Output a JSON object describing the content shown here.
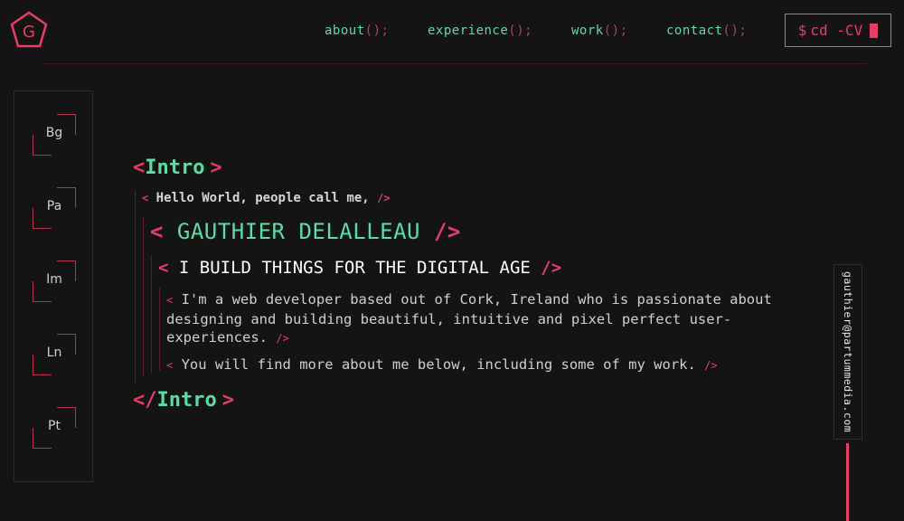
{
  "logo": {
    "letter": "G",
    "color": "#e63e66"
  },
  "nav": {
    "items": [
      {
        "label": "about",
        "suffix": "();"
      },
      {
        "label": "experience",
        "suffix": "();"
      },
      {
        "label": "work",
        "suffix": "();"
      },
      {
        "label": "contact",
        "suffix": "();"
      }
    ],
    "cv_prompt": "$",
    "cv_label": "cd -CV"
  },
  "sidebar": {
    "items": [
      {
        "symbol": "Bg",
        "icon": "github-icon"
      },
      {
        "symbol": "Pa",
        "icon": "codepen-icon"
      },
      {
        "symbol": "Im",
        "icon": "instagram-icon"
      },
      {
        "symbol": "Ln",
        "icon": "linkedin-icon"
      },
      {
        "symbol": "Pt",
        "icon": "twitter-icon"
      }
    ]
  },
  "intro": {
    "open_tag": "<",
    "close_open": "</",
    "end_tag": ">",
    "self_close": "/>",
    "section_name": "Intro",
    "hello": "Hello World, people call me,",
    "name": "GAUTHIER DELALLEAU",
    "tagline": "I BUILD THINGS FOR THE DIGITAL AGE",
    "paragraph1": "I'm a web developer based out of Cork, Ireland who is passionate about designing and building beautiful, intuitive and pixel perfect user-experiences.",
    "paragraph2": "You will find more about me below, including some of my work."
  },
  "email": "gauthier@partummedia.com",
  "colors": {
    "accent": "#e63e66",
    "green": "#5bdda6",
    "background": "#141414"
  }
}
